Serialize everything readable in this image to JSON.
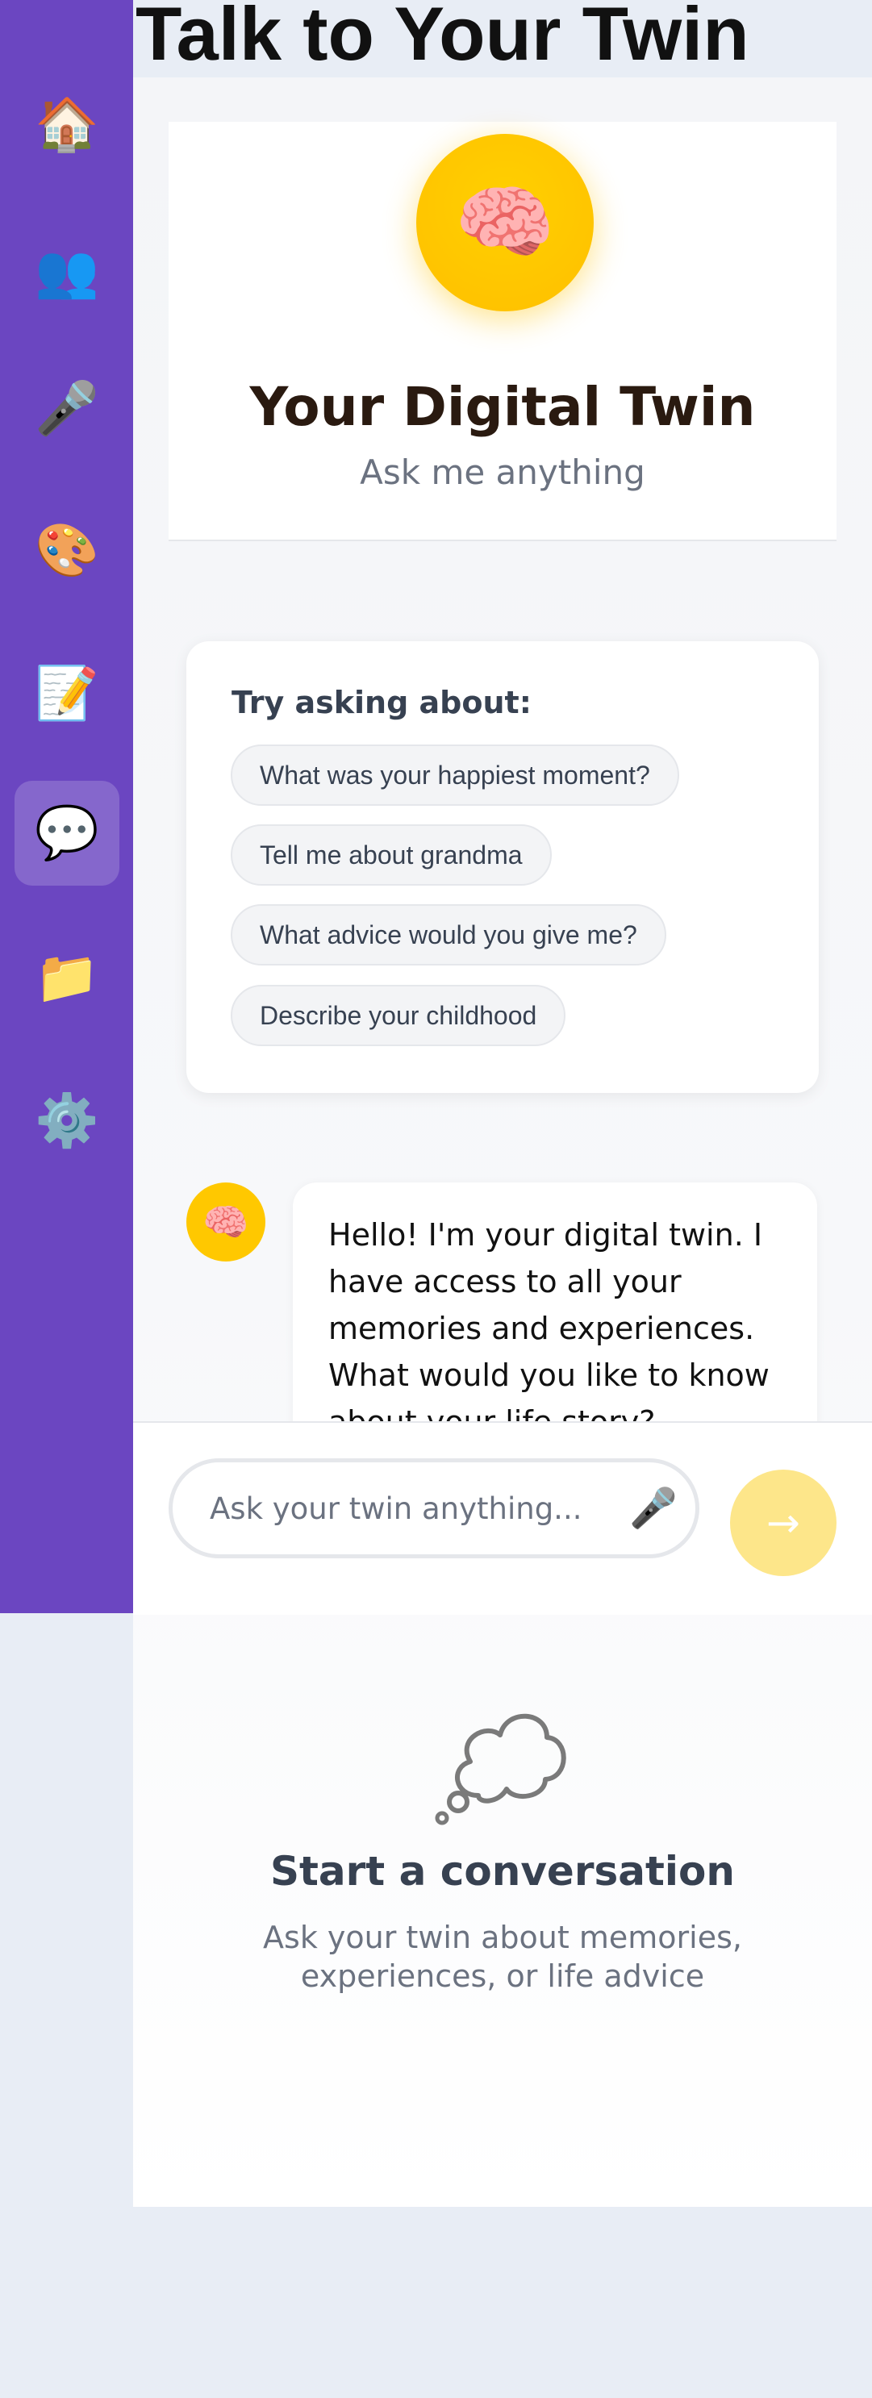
{
  "page": {
    "title": "Talk to Your Twin"
  },
  "sidebar": {
    "items": [
      {
        "name": "home",
        "icon": "🏠"
      },
      {
        "name": "people",
        "icon": "👥"
      },
      {
        "name": "record",
        "icon": "🎤"
      },
      {
        "name": "creative",
        "icon": "🎨"
      },
      {
        "name": "notes",
        "icon": "📝"
      },
      {
        "name": "chat",
        "icon": "💬"
      },
      {
        "name": "files",
        "icon": "📁"
      },
      {
        "name": "settings",
        "icon": "⚙️"
      }
    ],
    "active": "chat"
  },
  "twin": {
    "avatar_icon": "🧠",
    "title": "Your Digital Twin",
    "subtitle": "Ask me anything"
  },
  "suggestions": {
    "title": "Try asking about:",
    "items": [
      "What was your happiest moment?",
      "Tell me about grandma",
      "What advice would you give me?",
      "Describe your childhood"
    ]
  },
  "messages": [
    {
      "from": "twin",
      "avatar_icon": "🧠",
      "text": "Hello! I'm your digital twin. I have access to all your memories and experiences. What would you like to know about your life story?"
    }
  ],
  "composer": {
    "placeholder": "Ask your twin anything...",
    "mic_icon": "🎤",
    "send_icon": "→"
  },
  "empty_state": {
    "title": "Start a conversation",
    "subtitle": "Ask your twin about memories, experiences, or life advice"
  },
  "colors": {
    "sidebar": "#6b46c1",
    "accent": "#ffc800",
    "send_disabled": "#fde68a",
    "background": "#e8edf5"
  }
}
